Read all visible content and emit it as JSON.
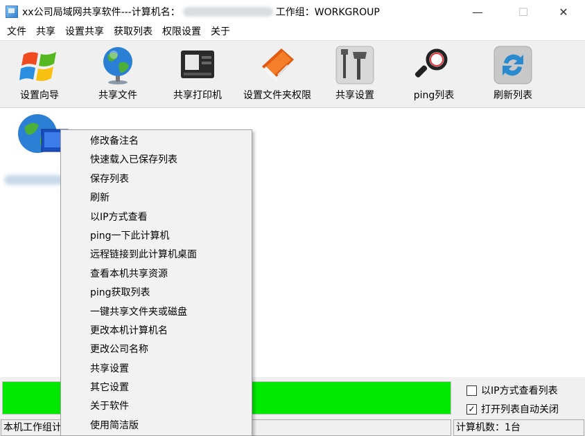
{
  "window": {
    "title_prefix": "xx公司局域网共享软件---计算机名：",
    "title_workgroup": "工作组：WORKGROUP",
    "min_glyph": "—",
    "max_glyph": "☐",
    "close_glyph": "✕"
  },
  "menubar": [
    "文件",
    "共享",
    "设置共享",
    "获取列表",
    "权限设置",
    "关于"
  ],
  "toolbar": [
    {
      "label": "设置向导",
      "icon": "windows-logo-icon"
    },
    {
      "label": "共享文件",
      "icon": "globe-icon"
    },
    {
      "label": "共享打印机",
      "icon": "printer-icon"
    },
    {
      "label": "设置文件夹权限",
      "icon": "folder-book-icon"
    },
    {
      "label": "共享设置",
      "icon": "tools-icon"
    },
    {
      "label": "ping列表",
      "icon": "magnifier-icon"
    },
    {
      "label": "刷新列表",
      "icon": "refresh-icon"
    }
  ],
  "context_menu": [
    "修改备注名",
    "快速载入已保存列表",
    "保存列表",
    "刷新",
    "以IP方式查看",
    "ping一下此计算机",
    "远程链接到此计算机桌面",
    "查看本机共享资源",
    "ping获取列表",
    "一键共享文件夹或磁盘",
    "更改本机计算机名",
    "更改公司名称",
    "共享设置",
    "其它设置",
    "关于软件",
    "使用简洁版"
  ],
  "options": {
    "ip_view_label": "以IP方式查看列表",
    "ip_view_checked": false,
    "auto_close_label": "打开列表自动关闭",
    "auto_close_checked": true,
    "check_mark": "✓"
  },
  "progress": {
    "fraction": 1.0,
    "color": "#00e800"
  },
  "status": {
    "workgroup_text": "本机工作组计",
    "count_text": "计算机数：1台"
  }
}
